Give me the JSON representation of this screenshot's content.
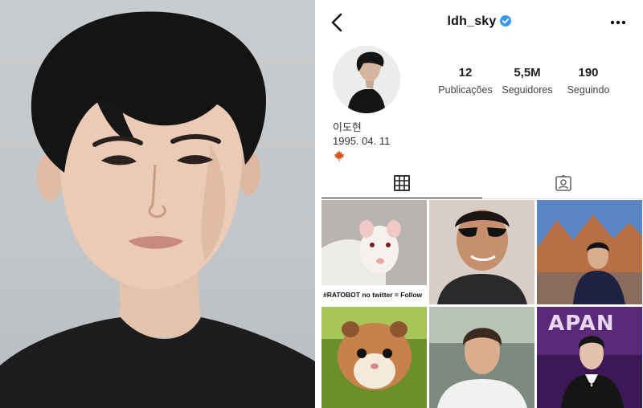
{
  "header": {
    "username": "ldh_sky",
    "back_icon": "chevron-left-icon",
    "verified_icon": "verified-badge-icon",
    "menu_icon": "more-horizontal-icon"
  },
  "stats": [
    {
      "value": "12",
      "label": "Publicações"
    },
    {
      "value": "5,5M",
      "label": "Seguidores"
    },
    {
      "value": "190",
      "label": "Seguindo"
    }
  ],
  "bio": {
    "name": "이도현",
    "birthdate": "1995. 04. 11",
    "emoji_icon": "maple-leaf-icon"
  },
  "tabs": [
    {
      "icon": "grid-icon",
      "active": true
    },
    {
      "icon": "tagged-person-icon",
      "active": false
    }
  ],
  "posts": [
    {
      "subject": "white rat",
      "caption": "#RATOBOT no twitter = Follow"
    },
    {
      "subject": "man with sunglasses"
    },
    {
      "subject": "man in front of mountains"
    },
    {
      "subject": "hamster"
    },
    {
      "subject": "man outdoors"
    },
    {
      "subject": "man in suit at awards",
      "overlay_text": "APAN"
    }
  ],
  "colors": {
    "verified_blue": "#3897f0",
    "text_primary": "#111111",
    "maple_leaf": "#d4541a"
  }
}
